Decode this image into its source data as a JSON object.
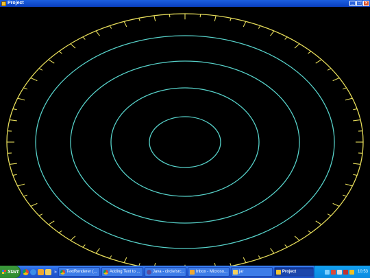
{
  "window": {
    "title": "Project",
    "icon": "java-applet-icon",
    "controls": [
      "minimize-icon",
      "maximize-icon",
      "close-icon"
    ]
  },
  "colors": {
    "background": "#000000",
    "ellipse": "#e6dc5a",
    "rings": "#56d0c8",
    "taskbar": "#245edb",
    "start_button": "#3a9a3a"
  },
  "taskbar": {
    "start_label": "Start",
    "quick_launch": [
      "chrome-icon",
      "ie-icon",
      "outlook-icon",
      "folder-icon"
    ],
    "overflow_label": "»",
    "tasks": [
      {
        "label": "TextRenderer (...",
        "icon": "chrome-icon",
        "active": false
      },
      {
        "label": "Adding Text to ...",
        "icon": "chrome-icon",
        "active": false
      },
      {
        "label": "Java - circle/src...",
        "icon": "eclipse-icon",
        "active": false
      },
      {
        "label": "Inbox - Microso...",
        "icon": "outlook-icon",
        "active": false
      },
      {
        "label": "jar",
        "icon": "folder-icon",
        "active": false
      },
      {
        "label": "Project",
        "icon": "java-applet-icon",
        "active": true
      }
    ],
    "tray_icons": [
      "network-icon",
      "shield-icon",
      "volume-icon",
      "antivirus-icon",
      "update-icon"
    ],
    "clock": "10:53"
  }
}
